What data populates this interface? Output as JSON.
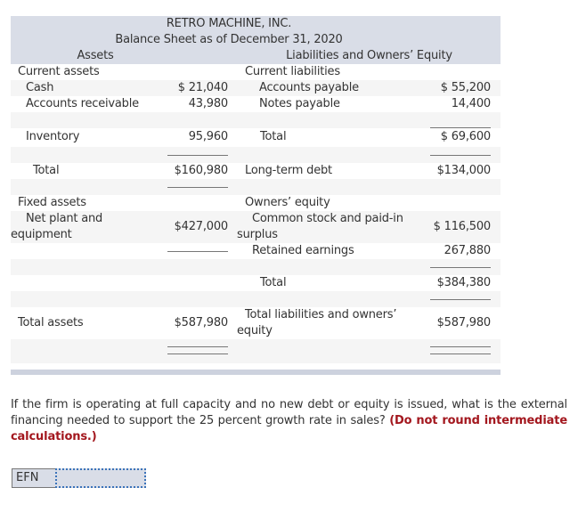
{
  "balance_sheet": {
    "company": "RETRO MACHINE, INC.",
    "subtitle": "Balance Sheet as of December 31, 2020",
    "assets_header": "Assets",
    "liabilities_header": "Liabilities and Owners’ Equity",
    "current_assets_label": "Current assets",
    "current_liabilities_label": "Current liabilities",
    "cash": {
      "label": "Cash",
      "value": "$ 21,040"
    },
    "accounts_payable": {
      "label": "Accounts payable",
      "value": "$ 55,200"
    },
    "accounts_receivable": {
      "label": "Accounts receivable",
      "value": "43,980"
    },
    "notes_payable": {
      "label": "Notes payable",
      "value": "14,400"
    },
    "inventory": {
      "label": "Inventory",
      "value": "95,960"
    },
    "current_liabilities_total": {
      "label": "Total",
      "value": "$ 69,600"
    },
    "current_assets_total": {
      "label": "Total",
      "value": "$160,980"
    },
    "long_term_debt": {
      "label": "Long-term debt",
      "value": "$134,000"
    },
    "fixed_assets_label": "Fixed assets",
    "owners_equity_label": "Owners’ equity",
    "net_plant": {
      "label_line1": "Net plant and",
      "label_line2": "equipment",
      "value": "$427,000"
    },
    "common_stock": {
      "label_line1": "Common stock and paid-in",
      "label_line2": "surplus",
      "value": "$ 116,500"
    },
    "retained_earnings": {
      "label": "Retained earnings",
      "value": "267,880"
    },
    "equity_total": {
      "label": "Total",
      "value": "$384,380"
    },
    "total_assets": {
      "label": "Total assets",
      "value": "$587,980"
    },
    "total_liabilities_equity": {
      "label_line1": "Total liabilities and owners’",
      "label_line2": "equity",
      "value": "$587,980"
    }
  },
  "question": {
    "text": "If the firm is operating at full capacity and no new debt or equity is issued, what is the external financing needed to support the 25 percent growth rate in sales? ",
    "emphasis": "(Do not round intermediate calculations.)"
  },
  "answer": {
    "label": "EFN",
    "value": ""
  }
}
